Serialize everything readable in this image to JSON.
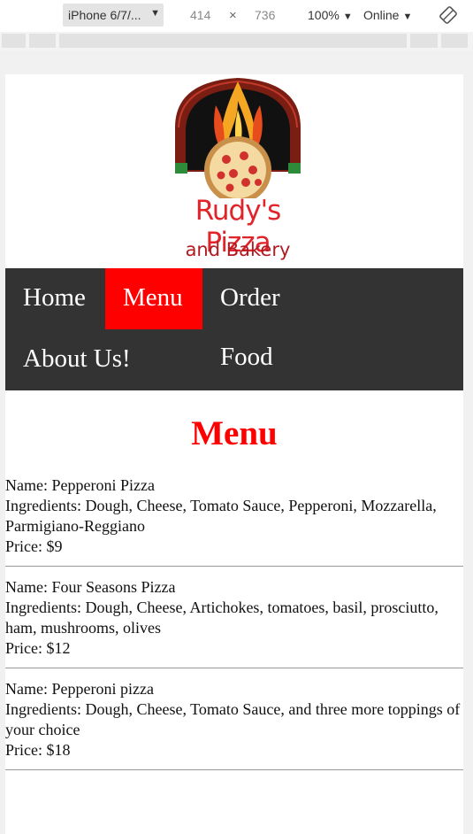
{
  "devtools": {
    "device": "iPhone 6/7/...",
    "width": "414",
    "times": "×",
    "height": "736",
    "zoom": "100%",
    "network": "Online",
    "caret": "▼"
  },
  "logo": {
    "line1": "Rudy's Pizza",
    "line2": "and Bakery"
  },
  "nav": {
    "home": "Home",
    "menu": "Menu",
    "order": "Order Food",
    "about": "About Us!"
  },
  "page": {
    "title": "Menu"
  },
  "menu_items": [
    {
      "name": "Name: Pepperoni Pizza",
      "ingredients": "Ingredients: Dough, Cheese, Tomato Sauce, Pepperoni, Mozzarella, Parmigiano-Reggiano",
      "price": "Price: $9"
    },
    {
      "name": "Name: Four Seasons Pizza",
      "ingredients": "Ingredients: Dough, Cheese, Artichokes, tomatoes, basil, prosciutto, ham, mushrooms, olives",
      "price": "Price: $12"
    },
    {
      "name": "Name: Pepperoni pizza",
      "ingredients": "Ingredients: Dough, Cheese, Tomato Sauce, and three more toppings of your choice",
      "price": "Price: $18"
    }
  ],
  "colors": {
    "nav_bg": "#333333",
    "accent": "#ff0000"
  }
}
